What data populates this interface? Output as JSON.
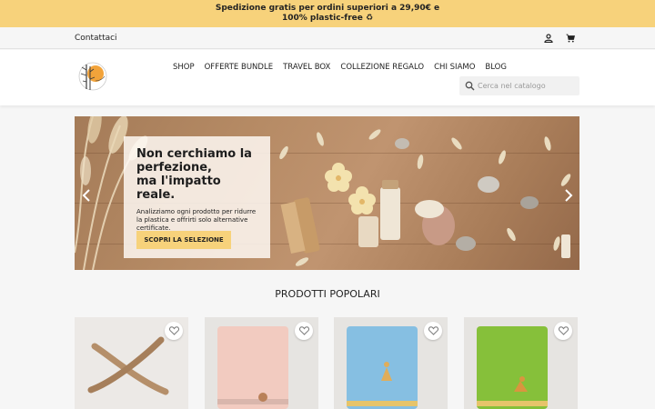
{
  "promo": {
    "line1": "Spedizione gratis per ordini superiori a 29,90€ e",
    "line2": "100% plastic-free ♻"
  },
  "topbar": {
    "contact": "Contattaci",
    "user_icon": "user-icon",
    "cart_icon": "cart-icon"
  },
  "nav": {
    "items": [
      "SHOP",
      "OFFERTE BUNDLE",
      "TRAVEL BOX",
      "COLLEZIONE REGALO",
      "CHI SIAMO",
      "BLOG"
    ]
  },
  "search": {
    "placeholder": "Cerca nel catalogo",
    "icon": "search-icon"
  },
  "hero": {
    "title_line1": "Non cerchiamo la",
    "title_line2": "perfezione,",
    "title_line3": "ma l'impatto reale.",
    "text": "Analizziamo ogni prodotto per ridurre la plastica e offrirti solo alternative certificate.",
    "cta": "SCOPRI LA SELEZIONE"
  },
  "popular": {
    "title": "PRODOTTI POPOLARI"
  },
  "colors": {
    "promo": "#f7d27b",
    "cta": "#f7d27b"
  }
}
